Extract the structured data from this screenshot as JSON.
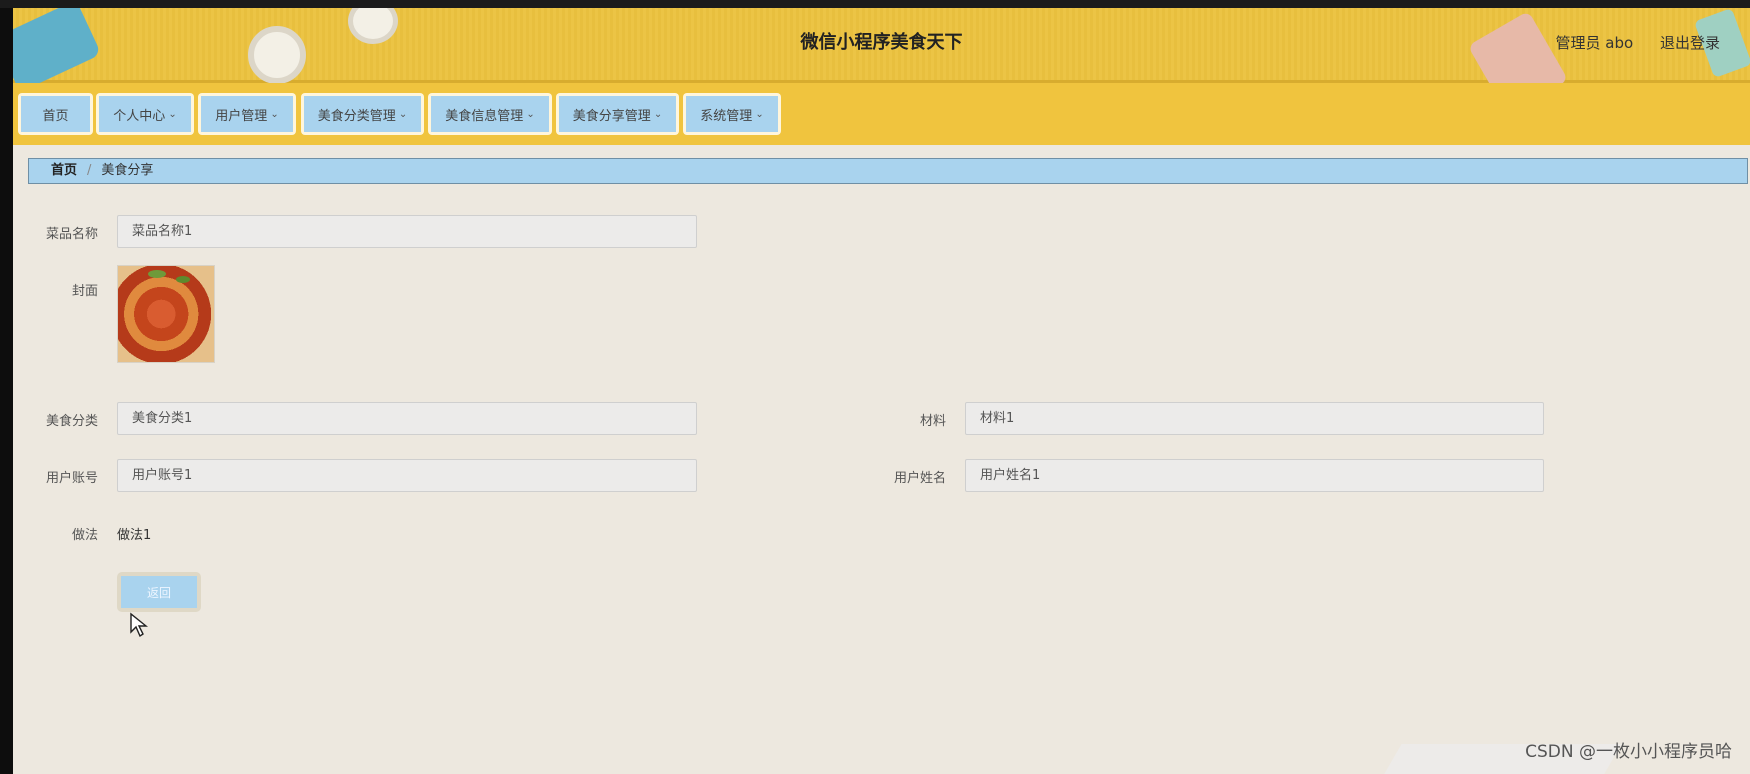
{
  "header": {
    "title": "微信小程序美食天下",
    "admin_label": "管理员 abo",
    "logout_label": "退出登录"
  },
  "nav": {
    "items": [
      {
        "label": "首页",
        "has_dropdown": false
      },
      {
        "label": "个人中心",
        "has_dropdown": true
      },
      {
        "label": "用户管理",
        "has_dropdown": true
      },
      {
        "label": "美食分类管理",
        "has_dropdown": true
      },
      {
        "label": "美食信息管理",
        "has_dropdown": true
      },
      {
        "label": "美食分享管理",
        "has_dropdown": true
      },
      {
        "label": "系统管理",
        "has_dropdown": true
      }
    ]
  },
  "breadcrumb": {
    "home": "首页",
    "separator": "/",
    "current": "美食分享"
  },
  "form": {
    "dish_name_label": "菜品名称",
    "dish_name_value": "菜品名称1",
    "cover_label": "封面",
    "category_label": "美食分类",
    "category_value": "美食分类1",
    "material_label": "材料",
    "material_value": "材料1",
    "account_label": "用户账号",
    "account_value": "用户账号1",
    "username_label": "用户姓名",
    "username_value": "用户姓名1",
    "method_label": "做法",
    "method_value": "做法1",
    "back_label": "返回"
  },
  "watermark": "CSDN @一枚小小程序员哈",
  "colors": {
    "header": "#ecc445",
    "nav_button": "#a9d3ee",
    "page_bg": "#ede8df"
  }
}
